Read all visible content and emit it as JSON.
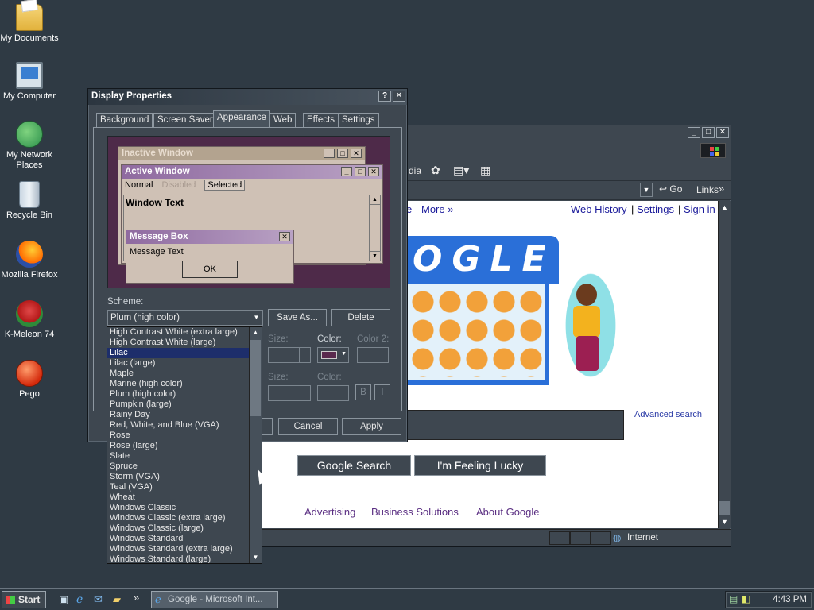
{
  "desktop": {
    "icons": [
      {
        "label": "My Documents",
        "icon": "folder-icon"
      },
      {
        "label": "My Computer",
        "icon": "computer-icon"
      },
      {
        "label": "My Network Places",
        "icon": "network-icon"
      },
      {
        "label": "Recycle Bin",
        "icon": "recycle-bin-icon"
      },
      {
        "label": "Mozilla Firefox",
        "icon": "firefox-icon"
      },
      {
        "label": "K-Meleon 74",
        "icon": "kmeleon-icon"
      },
      {
        "label": "Pego",
        "icon": "pego-icon"
      }
    ]
  },
  "ie": {
    "toolbar_media": "dia",
    "go_label": "Go",
    "links_label": "Links",
    "links_chevron": "»",
    "top_links": {
      "partial": "e",
      "more": "More »",
      "web_history": "Web History",
      "sep1": "|",
      "settings": "Settings",
      "sep2": "|",
      "sign_in": "Sign in"
    },
    "doodle_letters": "OGLE",
    "advanced_search": "Advanced search",
    "google_search": "Google Search",
    "feeling_lucky": "I'm Feeling Lucky",
    "footer": {
      "advertising": "Advertising",
      "business": "Business Solutions",
      "about": "About Google"
    },
    "status_zone": "Internet"
  },
  "dialog": {
    "title": "Display Properties",
    "help_btn": "?",
    "close_btn": "✕",
    "tabs": [
      "Background",
      "Screen Saver",
      "Appearance",
      "Web",
      "Effects",
      "Settings"
    ],
    "active_tab": "Appearance",
    "preview": {
      "inactive_title": "Inactive Window",
      "active_title": "Active Window",
      "menu_normal": "Normal",
      "menu_disabled": "Disabled",
      "menu_selected": "Selected",
      "window_text": "Window Text",
      "msgbox_title": "Message Box",
      "msgbox_text": "Message Text",
      "ok": "OK"
    },
    "scheme_label": "Scheme:",
    "scheme_value": "Plum (high color)",
    "save_as": "Save As...",
    "delete": "Delete",
    "size_label": "Size:",
    "color_label": "Color:",
    "color2_label": "Color 2:",
    "size2_label": "Size:",
    "color3_label": "Color:",
    "bold": "B",
    "italic": "I",
    "cancel": "Cancel",
    "apply": "Apply",
    "colors": {
      "swatch": "#5a2a4e",
      "preview_bg": "#4e2a49",
      "active_title": "#8f6aa0",
      "inactive_title": "#b3a38f"
    }
  },
  "scheme_list": {
    "selected": "Lilac",
    "items": [
      "High Contrast White (extra large)",
      "High Contrast White (large)",
      "Lilac",
      "Lilac (large)",
      "Maple",
      "Marine (high color)",
      "Plum (high color)",
      "Pumpkin (large)",
      "Rainy Day",
      "Red, White, and Blue (VGA)",
      "Rose",
      "Rose (large)",
      "Slate",
      "Spruce",
      "Storm (VGA)",
      "Teal (VGA)",
      "Wheat",
      "Windows Classic",
      "Windows Classic (extra large)",
      "Windows Classic (large)",
      "Windows Standard",
      "Windows Standard (extra large)",
      "Windows Standard (large)"
    ]
  },
  "taskbar": {
    "start": "Start",
    "task": "Google - Microsoft Int...",
    "quick_chevron": "»",
    "clock": "4:43 PM"
  }
}
